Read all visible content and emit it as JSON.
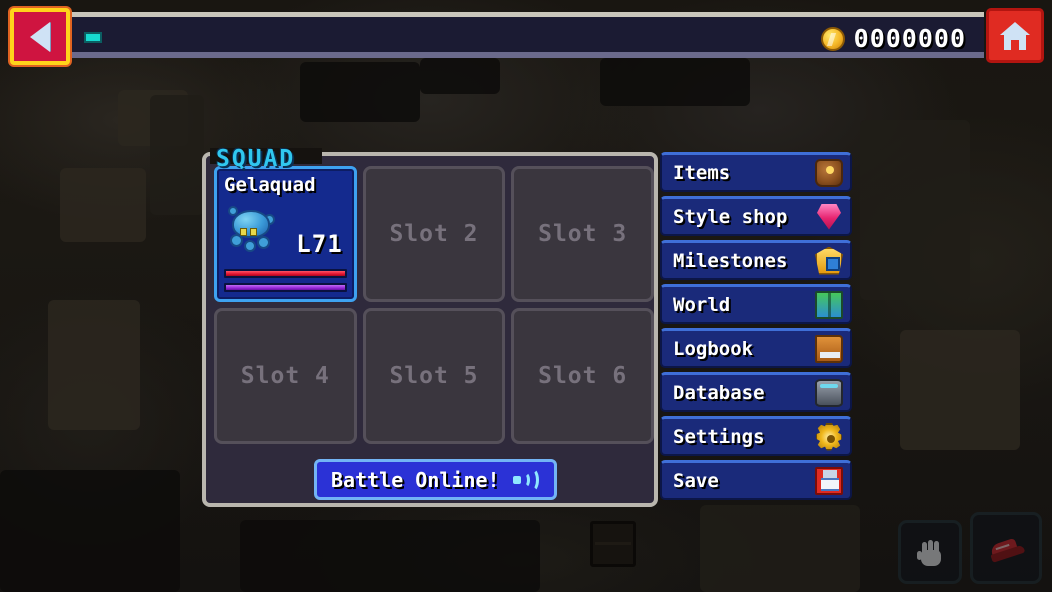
{
  "topbar": {
    "coin_value": "0000000",
    "coin_icon": "coin-icon",
    "xp_chip": "xp-chip",
    "back_icon": "arrow-left-icon",
    "home_icon": "home-icon"
  },
  "squad": {
    "title": "SQUAD",
    "slots": [
      {
        "filled": true,
        "name": "Gelaquad",
        "level": "L71",
        "hp_percent": 100,
        "mp_percent": 100,
        "sprite": "gelaquad-sprite"
      },
      {
        "filled": false,
        "label": "Slot 2"
      },
      {
        "filled": false,
        "label": "Slot 3"
      },
      {
        "filled": false,
        "label": "Slot 4"
      },
      {
        "filled": false,
        "label": "Slot 5"
      },
      {
        "filled": false,
        "label": "Slot 6"
      }
    ],
    "battle_button": {
      "label": "Battle Online!",
      "icon": "broadcast-icon"
    }
  },
  "menu": {
    "items": [
      {
        "label": "Items",
        "icon": "bag-icon"
      },
      {
        "label": "Style shop",
        "icon": "gem-icon"
      },
      {
        "label": "Milestones",
        "icon": "medal-icon"
      },
      {
        "label": "World",
        "icon": "map-icon"
      },
      {
        "label": "Logbook",
        "icon": "book-icon"
      },
      {
        "label": "Database",
        "icon": "database-icon"
      },
      {
        "label": "Settings",
        "icon": "gear-icon"
      },
      {
        "label": "Save",
        "icon": "floppy-icon"
      }
    ]
  },
  "pads": [
    {
      "icon": "hand-icon"
    },
    {
      "icon": "shoe-icon"
    }
  ],
  "colors": {
    "accent_cyan": "#30c7ee",
    "menu_blue": "#1a2a7a",
    "card_blue": "#142a8e",
    "hp_red": "#e21330",
    "mp_purple": "#9427d8",
    "panel_border": "#b9b6ae",
    "panel_bg": "#2f2a3c",
    "slot_bg": "#3a363e",
    "back_btn_red": "#cf1440",
    "back_btn_border": "#ffd31b",
    "home_btn_red": "#e02b22",
    "battle_blue": "#2b32d6"
  }
}
